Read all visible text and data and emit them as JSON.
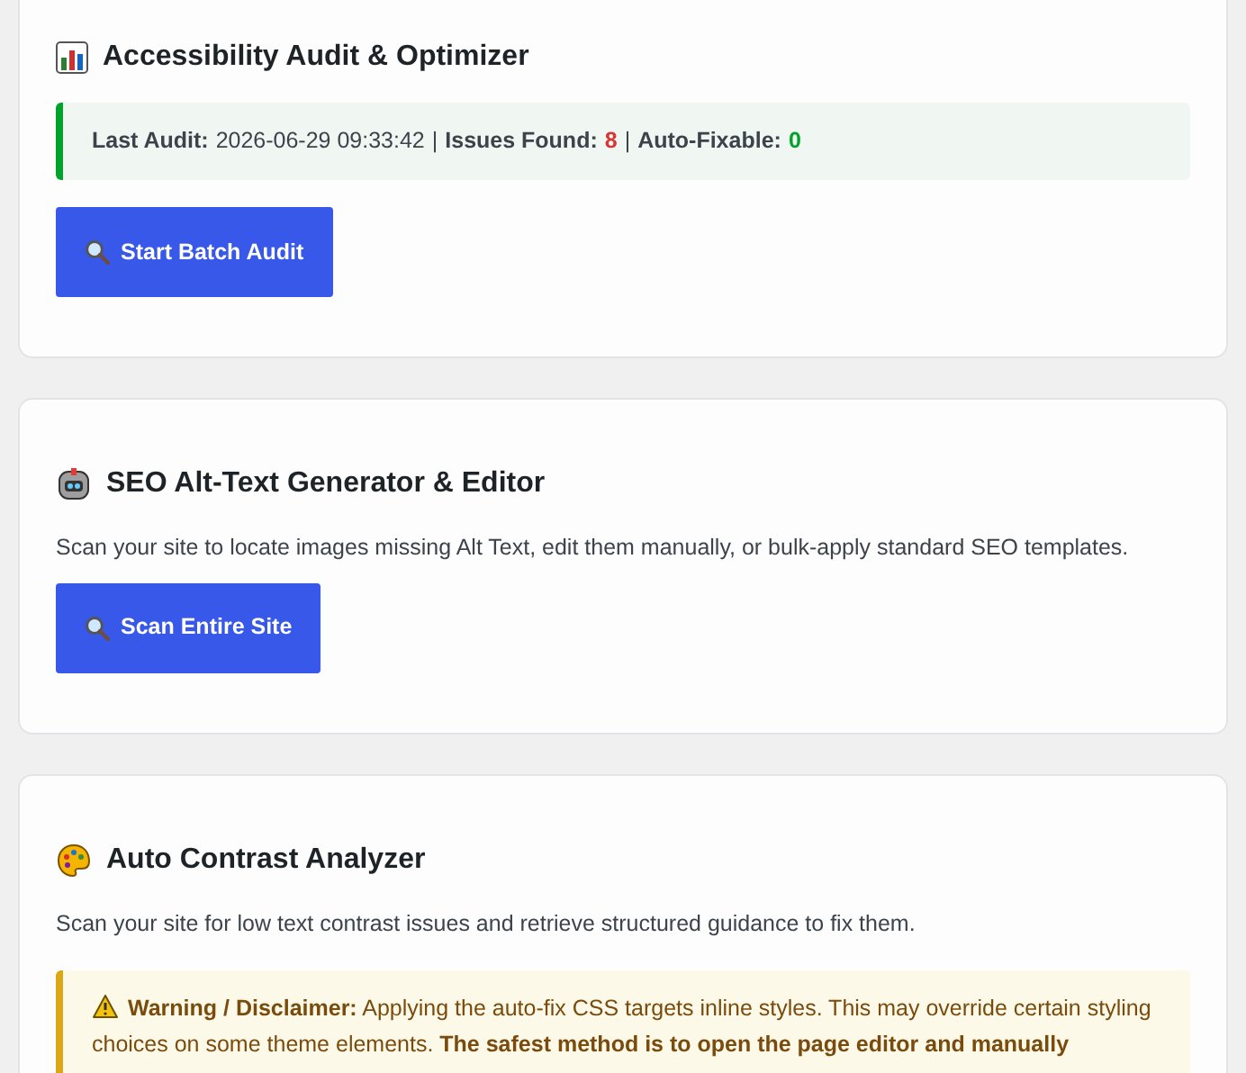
{
  "sections": [
    {
      "title": "Accessibility Audit & Optimizer",
      "status": [
        {
          "label": "Last Audit:",
          "value": "2026-06-29 09:33:42",
          "color": "#3c434a"
        },
        {
          "label": "Issues Found:",
          "value": "8",
          "color": "#d63638"
        },
        {
          "label": "Auto-Fixable:",
          "value": "0",
          "color": "#00a32a"
        }
      ],
      "status_separator": "|",
      "button": "Start Batch Audit"
    },
    {
      "title": "SEO Alt-Text Generator & Editor",
      "description": "Scan your site to locate images missing Alt Text, edit them manually, or bulk-apply standard SEO templates.",
      "button": "Scan Entire Site"
    },
    {
      "title": "Auto Contrast Analyzer",
      "description": "Scan your site for low text contrast issues and retrieve structured guidance to fix them.",
      "warning": "**Warning / Disclaimer:** Applying the auto-fix CSS targets inline styles. This may override certain styling choices on some theme elements. **The safest method is to open the page editor and manually**"
    }
  ]
}
